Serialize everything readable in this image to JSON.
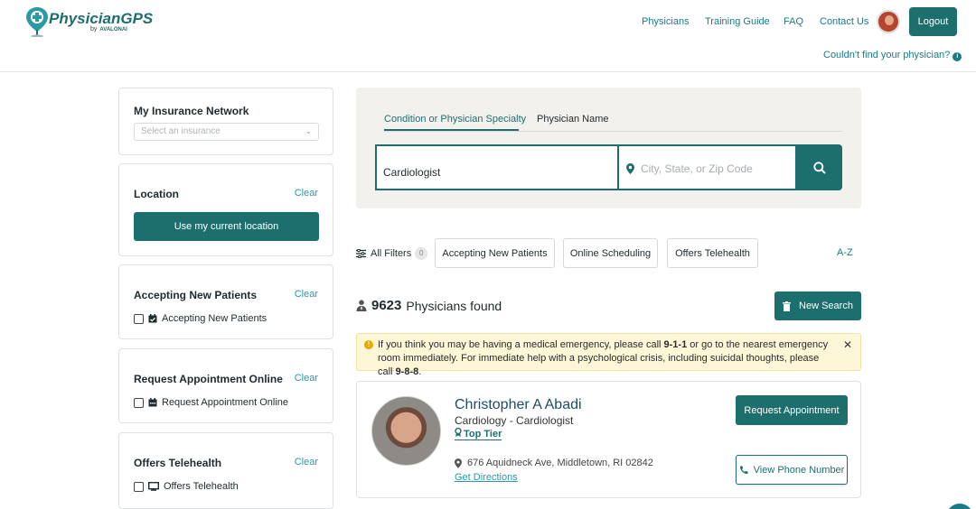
{
  "header": {
    "logo_text": "PhysicianGPS",
    "logo_by": "by",
    "logo_partner": "AVALONAI",
    "nav": [
      "Physicians",
      "Training Guide",
      "FAQ",
      "Contact Us"
    ],
    "logout_label": "Logout",
    "couldnt_find": "Couldn't find your physician?"
  },
  "sidebar": {
    "insurance": {
      "title": "My Insurance Network",
      "placeholder": "Select an insurance"
    },
    "location": {
      "title": "Location",
      "clear": "Clear",
      "button": "Use my current location"
    },
    "accepting": {
      "title": "Accepting New Patients",
      "clear": "Clear",
      "option": "Accepting New Patients"
    },
    "request": {
      "title": "Request Appointment Online",
      "clear": "Clear",
      "option": "Request Appointment Online"
    },
    "telehealth": {
      "title": "Offers Telehealth",
      "clear": "Clear",
      "option": "Offers Telehealth"
    }
  },
  "search": {
    "tabs": [
      "Condition or Physician Specialty",
      "Physician Name"
    ],
    "query": "Cardiologist",
    "location_placeholder": "City, State, or Zip Code"
  },
  "filters": {
    "all_label": "All Filters",
    "count": "0",
    "pills": [
      "Accepting New Patients",
      "Online Scheduling",
      "Offers Telehealth"
    ],
    "sort": "A-Z"
  },
  "results": {
    "count": "9623",
    "label": "Physicians found",
    "new_search": "New Search"
  },
  "alert": {
    "part1": "If you think you may be having a medical emergency, please call ",
    "num1": "9-1-1",
    "part2": " or go to the nearest emergency room immediately. For immediate help with a psychological crisis, including suicidal thoughts, please call ",
    "num2": "9-8-8",
    "part3": "."
  },
  "physician": {
    "name": "Christopher A Abadi",
    "specialty": "Cardiology - Cardiologist",
    "tier": "Top Tier",
    "address": "676 Aquidneck Ave, Middletown, RI 02842",
    "directions": "Get Directions",
    "request_button": "Request Appointment",
    "phone_button": "View Phone Number"
  },
  "colors": {
    "brand": "#1d6f6d",
    "link": "#1b7a85",
    "alert_bg": "#fdf7d7"
  }
}
